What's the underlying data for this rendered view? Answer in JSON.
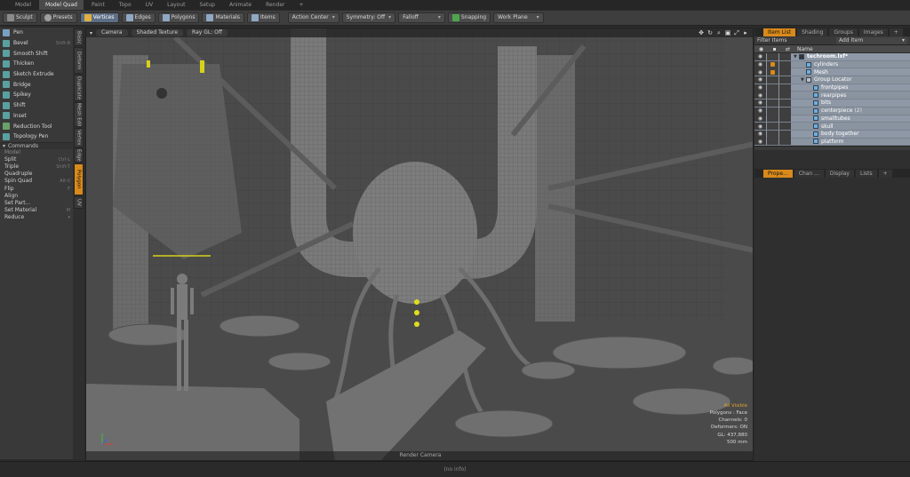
{
  "top_tabs": [
    {
      "label": "Model"
    },
    {
      "label": "Model Quad",
      "active": true
    },
    {
      "label": "Paint"
    },
    {
      "label": "Topo"
    },
    {
      "label": "UV"
    },
    {
      "label": "Layout"
    },
    {
      "label": "Setup"
    },
    {
      "label": "Animate"
    },
    {
      "label": "Render"
    },
    {
      "label": "+"
    }
  ],
  "toolbar": {
    "sculpt": "Sculpt",
    "presets": "Presets",
    "vertices": "Vertices",
    "edges": "Edges",
    "polygons": "Polygons",
    "materials": "Materials",
    "items": "Items",
    "action_center": "Action Center",
    "symmetry": "Symmetry: Off",
    "falloff": "Falloff",
    "snapping": "Snapping",
    "work_plane": "Work Plane"
  },
  "left_panel": {
    "tools": [
      {
        "label": "Pen",
        "shortcut": ""
      },
      {
        "label": "Bevel",
        "shortcut": "Shift-B"
      },
      {
        "label": "Smooth Shift",
        "shortcut": ""
      },
      {
        "label": "Thicken",
        "shortcut": ""
      },
      {
        "label": "Sketch Extrude",
        "shortcut": ""
      },
      {
        "label": "Bridge",
        "shortcut": ""
      },
      {
        "label": "Spikey",
        "shortcut": ""
      },
      {
        "label": "Shift",
        "shortcut": ""
      },
      {
        "label": "Inset",
        "shortcut": ""
      },
      {
        "label": "Reduction Tool",
        "shortcut": ""
      },
      {
        "label": "Topology Pen",
        "shortcut": ""
      }
    ],
    "commands_header": "Commands",
    "commands": [
      {
        "label": "Model",
        "shortcut": "",
        "muted": true
      },
      {
        "label": "Split",
        "shortcut": "Ctrl-L"
      },
      {
        "label": "Triple",
        "shortcut": "Shift-T"
      },
      {
        "label": "Quadruple",
        "shortcut": ""
      },
      {
        "label": "Spin Quad",
        "shortcut": "Alt-V"
      },
      {
        "label": "Flip",
        "shortcut": "F"
      },
      {
        "label": "Align",
        "shortcut": ""
      },
      {
        "label": "Set Part...",
        "shortcut": ""
      },
      {
        "label": "Set Material",
        "shortcut": "M"
      },
      {
        "label": "Reduce",
        "shortcut": "▾"
      }
    ]
  },
  "vertical_tabs": [
    "Basic",
    "Deform",
    "Duplicate",
    "Mesh Edit",
    "Vertex",
    "Edge",
    "Polygon",
    "UV"
  ],
  "active_vertical_tab": "Polygon",
  "viewport": {
    "camera": "Camera",
    "shading": "Shaded Texture",
    "ray_gl": "Ray GL: Off",
    "render_camera": "Render Camera",
    "stats": {
      "all_visible": "All Visible",
      "polygons": "Polygons : Face",
      "channels": "Channels: 0",
      "deformers": "Deformers: ON",
      "gl": "GL: 437,880",
      "scale": "500 mm"
    }
  },
  "status_bar": "(no info)",
  "right_panel": {
    "tabs": [
      {
        "label": "Item List",
        "active": true
      },
      {
        "label": "Shading"
      },
      {
        "label": "Groups"
      },
      {
        "label": "Images"
      },
      {
        "label": "+"
      }
    ],
    "filter_label": "Filter Items",
    "add_item": "Add Item",
    "name_header": "Name",
    "items": [
      {
        "name": "techroom.lxf*",
        "depth": 0,
        "arrow": "▼",
        "bold": true
      },
      {
        "name": "cylinders",
        "depth": 1,
        "locked": true
      },
      {
        "name": "Mesh",
        "depth": 1,
        "locked": true
      },
      {
        "name": "Group Locator",
        "depth": 1,
        "arrow": "▼"
      },
      {
        "name": "frontpipes",
        "depth": 2
      },
      {
        "name": "rearpipes",
        "depth": 2
      },
      {
        "name": "bits",
        "depth": 2
      },
      {
        "name": "centerpiece",
        "depth": 2,
        "count": "(2)"
      },
      {
        "name": "smalltubes",
        "depth": 2
      },
      {
        "name": "skull",
        "depth": 2
      },
      {
        "name": "body together",
        "depth": 2
      },
      {
        "name": "platform",
        "depth": 2
      }
    ],
    "bottom_tabs": [
      {
        "label": "Prope...",
        "active": true
      },
      {
        "label": "Chan ..."
      },
      {
        "label": "Display"
      },
      {
        "label": "Lists"
      },
      {
        "label": "+"
      }
    ]
  },
  "colors": {
    "accent": "#d98a1a",
    "viewport_bg": "#4a4a4a",
    "item_list_bg": "#8a93a0"
  }
}
